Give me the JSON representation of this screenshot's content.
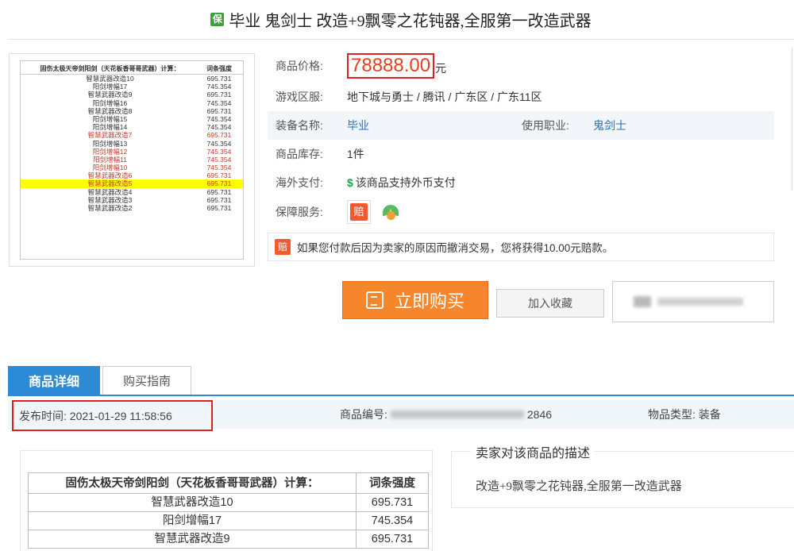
{
  "title": {
    "badge": "保",
    "text": "毕业 鬼剑士 改造+9飘零之花钝器,全服第一改造武器"
  },
  "thumbnail_table": {
    "header": [
      "固伤太极天帝剑阳剑（天花板香哥哥武器）计算：",
      "词条强度"
    ],
    "rows": [
      {
        "name": "智慧武器改造10",
        "value": "695.731",
        "style": "normal"
      },
      {
        "name": "阳剑增幅17",
        "value": "745.354",
        "style": "normal"
      },
      {
        "name": "智慧武器改造9",
        "value": "695.731",
        "style": "normal"
      },
      {
        "name": "阳剑增幅16",
        "value": "745.354",
        "style": "normal"
      },
      {
        "name": "智慧武器改造8",
        "value": "695.731",
        "style": "normal"
      },
      {
        "name": "阳剑增幅15",
        "value": "745.354",
        "style": "normal"
      },
      {
        "name": "阳剑增幅14",
        "value": "745.354",
        "style": "normal"
      },
      {
        "name": "智慧武器改造7",
        "value": "695.731",
        "style": "red"
      },
      {
        "name": "阳剑增幅13",
        "value": "745.354",
        "style": "normal"
      },
      {
        "name": "阳剑增幅12",
        "value": "745.354",
        "style": "red"
      },
      {
        "name": "阳剑增幅11",
        "value": "745.354",
        "style": "red"
      },
      {
        "name": "阳剑增幅10",
        "value": "745.354",
        "style": "red"
      },
      {
        "name": "智慧武器改造6",
        "value": "695.731",
        "style": "red"
      },
      {
        "name": "智慧武器改造5",
        "value": "695.731",
        "style": "yellow"
      },
      {
        "name": "智慧武器改造4",
        "value": "695.731",
        "style": "normal"
      },
      {
        "name": "智慧武器改造3",
        "value": "695.731",
        "style": "normal"
      },
      {
        "name": "智慧武器改造2",
        "value": "695.731",
        "style": "normal"
      }
    ]
  },
  "info": {
    "price_label": "商品价格:",
    "price": "78888.00",
    "price_unit": "元",
    "region_label": "游戏区服:",
    "region": "地下城与勇士 / 腾讯 / 广东区 / 广东11区",
    "equip_label": "装备名称:",
    "equip": "毕业",
    "job_label": "使用职业:",
    "job": "鬼剑士",
    "stock_label": "商品库存:",
    "stock": "1件",
    "overseas_label": "海外支付:",
    "overseas_icon": "$",
    "overseas": "该商品支持外币支付",
    "service_label": "保障服务:",
    "service_icon": "赔",
    "compensation_icon": "赔",
    "compensation": "如果您付款后因为卖家的原因而撤消交易，您将获得10.00元赔款。"
  },
  "actions": {
    "buy": "立即购买",
    "favorite": "加入收藏"
  },
  "tabs": [
    {
      "label": "商品详细",
      "active": true
    },
    {
      "label": "购买指南",
      "active": false
    }
  ],
  "meta": {
    "publish_time": "发布时间:  2021-01-29 11:58:56",
    "product_no_label": "商品编号:",
    "product_no_tail": "2846",
    "item_type": "物品类型:  装备"
  },
  "detail_table": {
    "header": [
      "固伤太极天帝剑阳剑（天花板香哥哥武器）计算：",
      "词条强度"
    ],
    "rows": [
      {
        "name": "智慧武器改造10",
        "value": "695.731"
      },
      {
        "name": "阳剑增幅17",
        "value": "745.354"
      },
      {
        "name": "智慧武器改造9",
        "value": "695.731"
      }
    ]
  },
  "seller": {
    "title": "卖家对该商品的描述",
    "text": "改造+9飘零之花钝器,全服第一改造武器"
  }
}
